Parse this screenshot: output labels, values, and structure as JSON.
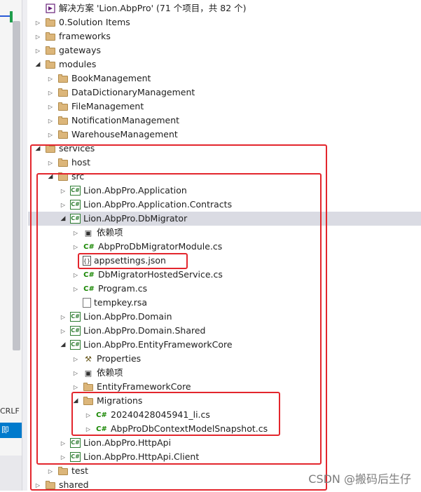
{
  "left_panel": {
    "line_ending": "CRLF",
    "tab_label": "即"
  },
  "tree": [
    {
      "key": "solution",
      "label": "解决方案 'Lion.AbpPro' (71 个项目，共 82 个)",
      "icon": "solution-icon",
      "indent": 0,
      "arrow": "none"
    },
    {
      "key": "solution-items",
      "label": "0.Solution Items",
      "icon": "folder-icon",
      "indent": 0,
      "arrow": "collapsed"
    },
    {
      "key": "frameworks",
      "label": "frameworks",
      "icon": "folder-icon",
      "indent": 0,
      "arrow": "collapsed"
    },
    {
      "key": "gateways",
      "label": "gateways",
      "icon": "folder-icon",
      "indent": 0,
      "arrow": "collapsed"
    },
    {
      "key": "modules",
      "label": "modules",
      "icon": "folder-icon",
      "indent": 0,
      "arrow": "expanded"
    },
    {
      "key": "bookmanagement",
      "label": "BookManagement",
      "icon": "folder-icon",
      "indent": 1,
      "arrow": "collapsed"
    },
    {
      "key": "datadictionary",
      "label": "DataDictionaryManagement",
      "icon": "folder-icon",
      "indent": 1,
      "arrow": "collapsed"
    },
    {
      "key": "filemanagement",
      "label": "FileManagement",
      "icon": "folder-icon",
      "indent": 1,
      "arrow": "collapsed"
    },
    {
      "key": "notification",
      "label": "NotificationManagement",
      "icon": "folder-icon",
      "indent": 1,
      "arrow": "collapsed"
    },
    {
      "key": "warehouse",
      "label": "WarehouseManagement",
      "icon": "folder-icon",
      "indent": 1,
      "arrow": "collapsed"
    },
    {
      "key": "services",
      "label": "services",
      "icon": "folder-icon",
      "indent": 0,
      "arrow": "expanded"
    },
    {
      "key": "host",
      "label": "host",
      "icon": "folder-icon",
      "indent": 1,
      "arrow": "collapsed"
    },
    {
      "key": "src",
      "label": "src",
      "icon": "folder-icon",
      "indent": 1,
      "arrow": "expanded"
    },
    {
      "key": "application",
      "label": "Lion.AbpPro.Application",
      "icon": "csharp-project-icon",
      "indent": 2,
      "arrow": "collapsed"
    },
    {
      "key": "application-contracts",
      "label": "Lion.AbpPro.Application.Contracts",
      "icon": "csharp-project-icon",
      "indent": 2,
      "arrow": "collapsed"
    },
    {
      "key": "dbmigrator",
      "label": "Lion.AbpPro.DbMigrator",
      "icon": "csharp-project-icon",
      "indent": 2,
      "arrow": "expanded",
      "selected": true
    },
    {
      "key": "deps-1",
      "label": "依赖项",
      "icon": "dependencies-icon",
      "indent": 3,
      "arrow": "collapsed"
    },
    {
      "key": "module-cs",
      "label": "AbpProDbMigratorModule.cs",
      "icon": "csharp-file-icon",
      "indent": 3,
      "arrow": "collapsed"
    },
    {
      "key": "appsettings",
      "label": "appsettings.json",
      "icon": "json-file-icon",
      "indent": 3,
      "arrow": "none"
    },
    {
      "key": "hosted-service",
      "label": "DbMigratorHostedService.cs",
      "icon": "csharp-file-icon",
      "indent": 3,
      "arrow": "collapsed"
    },
    {
      "key": "program",
      "label": "Program.cs",
      "icon": "csharp-file-icon",
      "indent": 3,
      "arrow": "collapsed"
    },
    {
      "key": "tempkey",
      "label": "tempkey.rsa",
      "icon": "file-icon",
      "indent": 3,
      "arrow": "none"
    },
    {
      "key": "domain",
      "label": "Lion.AbpPro.Domain",
      "icon": "csharp-project-icon",
      "indent": 2,
      "arrow": "collapsed"
    },
    {
      "key": "domain-shared",
      "label": "Lion.AbpPro.Domain.Shared",
      "icon": "csharp-project-icon",
      "indent": 2,
      "arrow": "collapsed"
    },
    {
      "key": "efcore",
      "label": "Lion.AbpPro.EntityFrameworkCore",
      "icon": "csharp-project-icon",
      "indent": 2,
      "arrow": "expanded"
    },
    {
      "key": "properties",
      "label": "Properties",
      "icon": "properties-icon",
      "indent": 3,
      "arrow": "collapsed"
    },
    {
      "key": "deps-2",
      "label": "依赖项",
      "icon": "dependencies-icon",
      "indent": 3,
      "arrow": "collapsed"
    },
    {
      "key": "efcore-folder",
      "label": "EntityFrameworkCore",
      "icon": "folder-icon",
      "indent": 3,
      "arrow": "collapsed"
    },
    {
      "key": "migrations",
      "label": "Migrations",
      "icon": "folder-icon",
      "indent": 3,
      "arrow": "expanded"
    },
    {
      "key": "migration-li",
      "label": "20240428045941_li.cs",
      "icon": "csharp-file-icon",
      "indent": 4,
      "arrow": "collapsed"
    },
    {
      "key": "snapshot",
      "label": "AbpProDbContextModelSnapshot.cs",
      "icon": "csharp-file-icon",
      "indent": 4,
      "arrow": "collapsed"
    },
    {
      "key": "httpapi",
      "label": "Lion.AbpPro.HttpApi",
      "icon": "csharp-project-icon",
      "indent": 2,
      "arrow": "collapsed"
    },
    {
      "key": "httpapi-client",
      "label": "Lion.AbpPro.HttpApi.Client",
      "icon": "csharp-project-icon",
      "indent": 2,
      "arrow": "collapsed"
    },
    {
      "key": "test",
      "label": "test",
      "icon": "folder-icon",
      "indent": 1,
      "arrow": "collapsed"
    },
    {
      "key": "shared",
      "label": "shared",
      "icon": "folder-icon",
      "indent": 0,
      "arrow": "collapsed"
    }
  ],
  "watermark": "CSDN @搬码后生仔",
  "colors": {
    "highlight_border": "#e3262d",
    "selected_row": "#dadbe3",
    "folder": "#dcb67a",
    "csharp": "#178600",
    "solution": "#68217a"
  }
}
